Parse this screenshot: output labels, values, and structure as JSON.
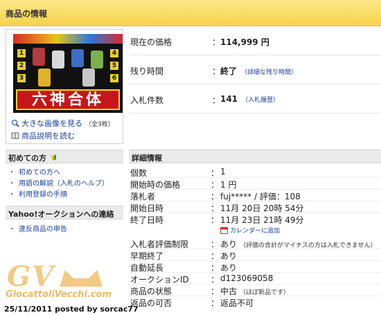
{
  "header": {
    "title": "商品の情報"
  },
  "thumbnail": {
    "kanji": "六神合体",
    "numbers": [
      "1",
      "2",
      "3",
      "4",
      "5",
      "6"
    ],
    "view_large_label": "大きな画像を見る",
    "view_large_note": "（全3枚）",
    "read_desc_label": "商品説明を読む"
  },
  "summary": {
    "price": {
      "label": "現在の価格",
      "colon": "：",
      "value": "114,999 円"
    },
    "time_left": {
      "label": "残り時間",
      "colon": "：",
      "value": "終了",
      "link": "（詳細な残り時間）"
    },
    "bids": {
      "label": "入札件数",
      "colon": "：",
      "value": "141",
      "link": "（入札履歴）"
    }
  },
  "sidebar": {
    "beginner_head": "初めての方",
    "beginner_links": [
      "初めての方へ",
      "用語の解説（入札のヘルプ）",
      "利用登録の手順"
    ],
    "contact_head": "Yahoo!オークションへの連絡",
    "contact_links": [
      "違反商品の申告"
    ]
  },
  "details": {
    "head": "詳細情報",
    "rows": [
      {
        "label": "個数",
        "value": "1"
      },
      {
        "label": "開始時の価格",
        "value": "1 円"
      },
      {
        "label": "落札者",
        "value": "fuj***** / 評価：108"
      },
      {
        "label": "開始日時",
        "value": "11月 20日 20時 54分"
      },
      {
        "label": "終了日時",
        "value": "11月 23日 21時 49分"
      },
      {
        "label": "入札者評価制限",
        "value": "あり",
        "note": "（評価の合計がマイナスの方は入札できません）"
      },
      {
        "label": "早期終了",
        "value": "あり"
      },
      {
        "label": "自動延長",
        "value": "あり"
      },
      {
        "label": "オークションID",
        "value": "d123069058"
      },
      {
        "label": "商品の状態",
        "value": "中古",
        "note": "（ほぼ新品です）"
      },
      {
        "label": "返品の可否",
        "value": "返品不可"
      }
    ],
    "colon": "：",
    "calendar_link": "カレンダーに追加"
  },
  "watermark": {
    "letters": "GV",
    "site": "GiocattoliVecchi.com",
    "posted": "25/11/2011 posted by sorcac77"
  },
  "colors": {
    "header_bg": "#f6d24b",
    "link": "#1a3fa0",
    "section_bg": "#eaeaea"
  }
}
